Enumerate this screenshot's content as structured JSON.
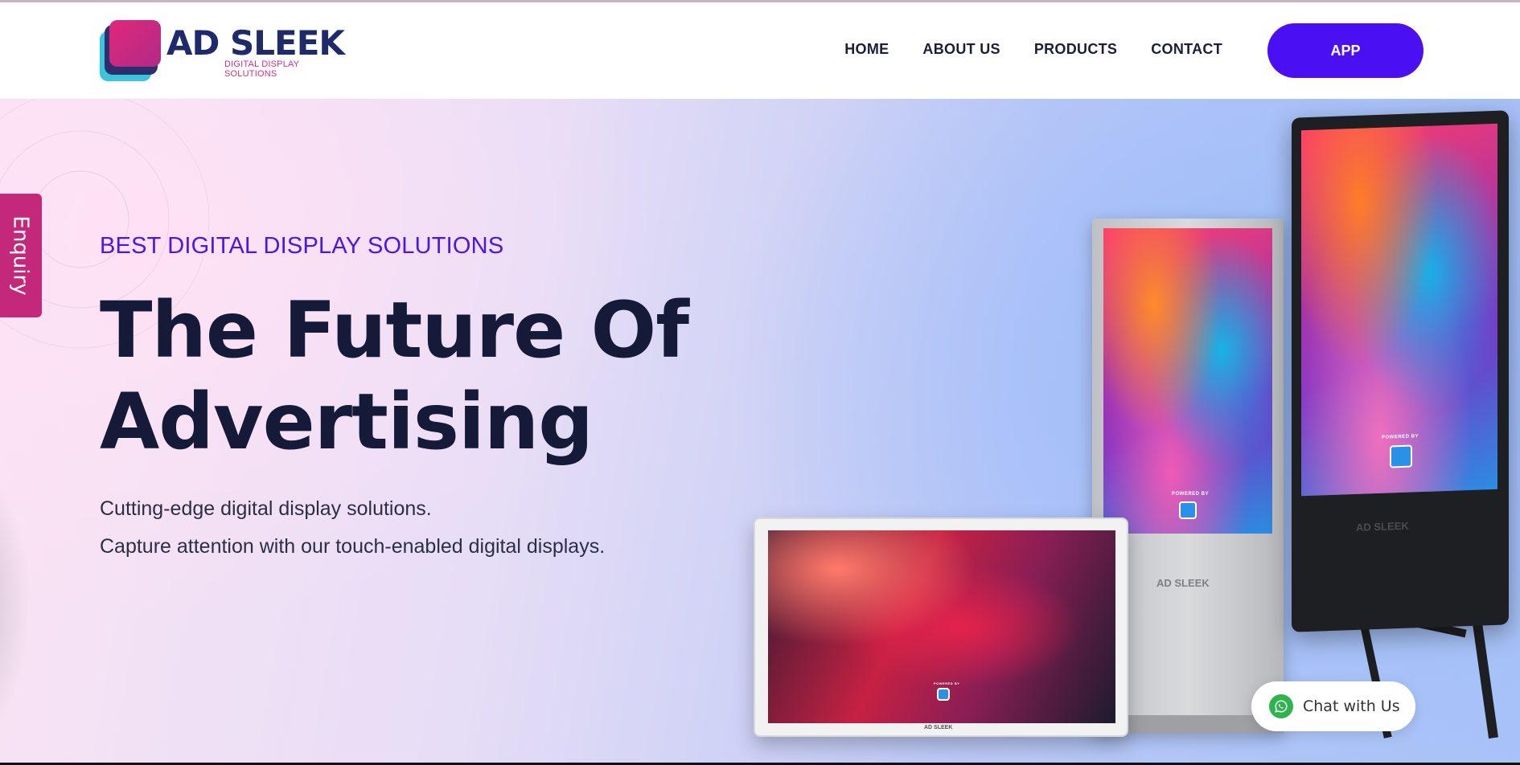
{
  "brand": {
    "name": "AD SLEEK",
    "tagline": "DIGITAL DISPLAY SOLUTIONS",
    "accent": "#4a10f2",
    "pink": "#c4287a"
  },
  "nav": {
    "items": [
      {
        "label": "HOME"
      },
      {
        "label": "ABOUT US"
      },
      {
        "label": "PRODUCTS"
      },
      {
        "label": "CONTACT"
      }
    ],
    "app_label": "APP"
  },
  "sidebar": {
    "enquiry_label": "Enquiry"
  },
  "hero": {
    "eyebrow": "BEST DIGITAL DISPLAY SOLUTIONS",
    "title_line1": "The Future Of",
    "title_line2": "Advertising",
    "desc_line1": "Cutting-edge digital display solutions.",
    "desc_line2": "Capture attention with our touch-enabled digital displays."
  },
  "products": {
    "kiosk_brand": "AD SLEEK",
    "aframe_brand": "AD SLEEK",
    "tv_brand": "AD SLEEK",
    "powered_by": "POWERED BY"
  },
  "chat": {
    "label": "Chat with Us",
    "icon": "whatsapp-icon"
  }
}
